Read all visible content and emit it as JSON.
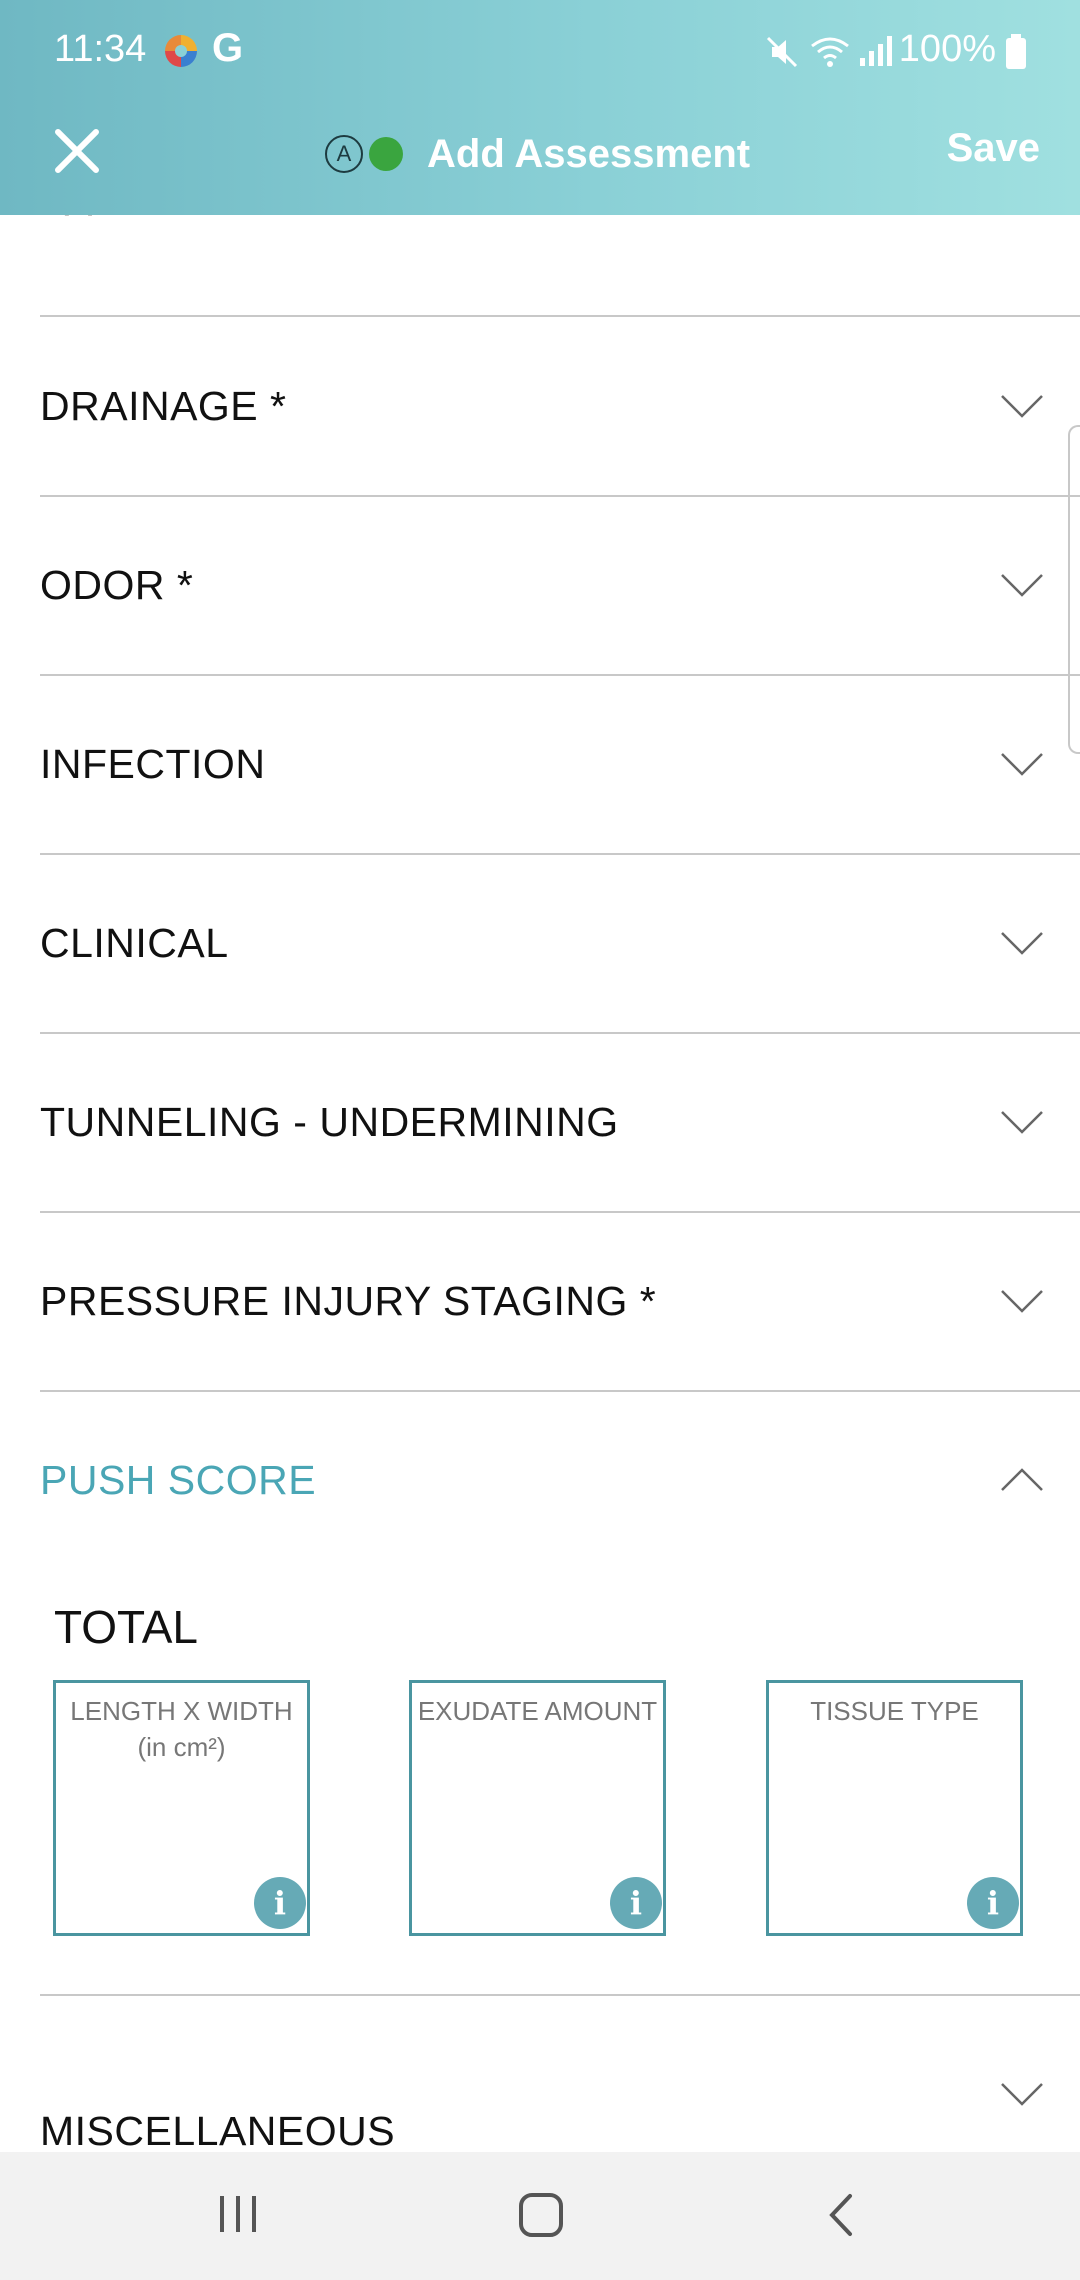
{
  "status_bar": {
    "time": "11:34",
    "battery": "100%",
    "icons": [
      "app-icon",
      "google-g-icon",
      "mute-icon",
      "wifi-icon",
      "signal-icon",
      "battery-icon"
    ]
  },
  "toolbar": {
    "close_icon": "close-icon",
    "badge": "A",
    "status_color": "#3aa53f",
    "title": "Add Assessment",
    "save_label": "Save"
  },
  "sections": [
    {
      "label": "PAIN *"
    },
    {
      "label": "DRAINAGE *"
    },
    {
      "label": "ODOR *"
    },
    {
      "label": "INFECTION"
    },
    {
      "label": "CLINICAL"
    },
    {
      "label": "TUNNELING - UNDERMINING"
    },
    {
      "label": "PRESSURE INJURY STAGING *"
    },
    {
      "label": "PUSH SCORE"
    },
    {
      "label": "MISCELLANEOUS"
    }
  ],
  "push_score": {
    "total_label": "TOTAL",
    "boxes": [
      {
        "line1": "LENGTH X WIDTH",
        "line2": "(in cm²)"
      },
      {
        "line1": "EXUDATE AMOUNT",
        "line2": ""
      },
      {
        "line1": "TISSUE TYPE",
        "line2": ""
      }
    ],
    "info_glyph": "i"
  },
  "colors": {
    "accent": "#4aa6b5",
    "header_start": "#6fb8c3",
    "header_end": "#a0e0e0"
  }
}
